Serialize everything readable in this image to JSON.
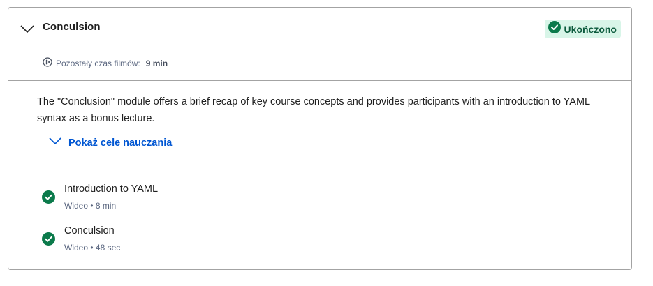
{
  "module": {
    "title": "Conculsion",
    "status": "Ukończono",
    "remaining_label": "Pozostały czas filmów:",
    "remaining_value": "9 min",
    "description": "The \"Conclusion\" module offers a brief recap of key course concepts and provides participants with an introduction to YAML syntax as a bonus lecture.",
    "objectives_label": "Pokaż cele nauczania"
  },
  "lessons": [
    {
      "title": "Introduction to YAML",
      "type": "Wideo",
      "duration": "8 min"
    },
    {
      "title": "Conculsion",
      "type": "Wideo",
      "duration": "48 sec"
    }
  ],
  "icons": {
    "collapse": "chevron-down-icon",
    "status": "check-circle-icon",
    "video": "play-circle-icon",
    "objectives": "chevron-down-icon",
    "lesson_done": "check-circle-icon"
  },
  "colors": {
    "success": "#0b7a4b",
    "badge_bg": "#d8f5e8",
    "link": "#0056d2",
    "border": "#a3a3a3"
  }
}
